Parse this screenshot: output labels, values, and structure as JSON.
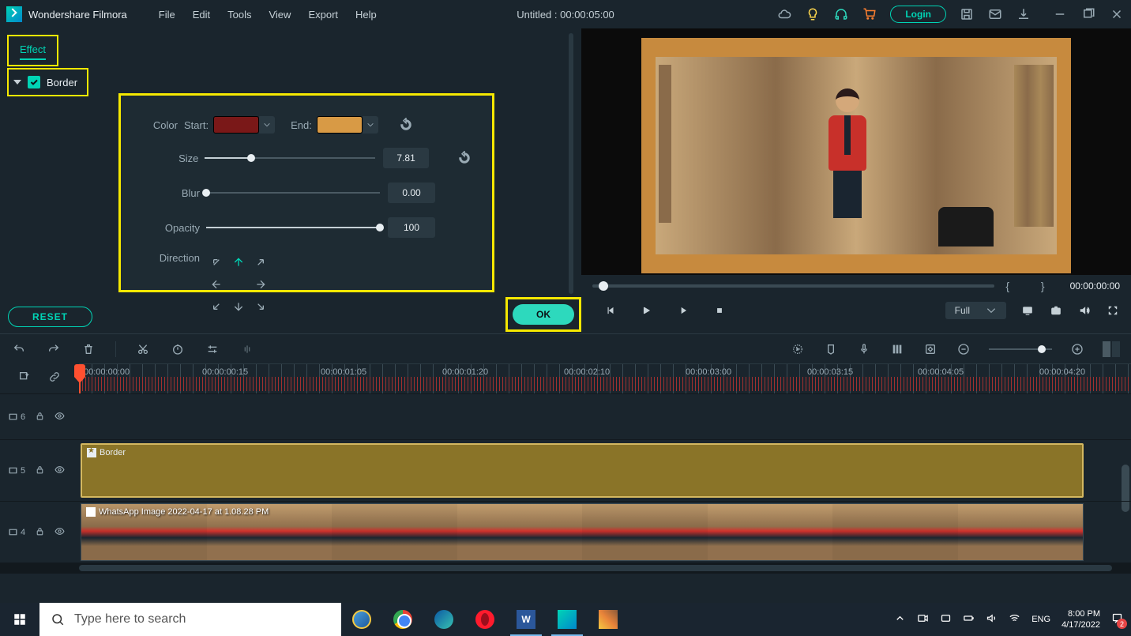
{
  "app": {
    "name": "Wondershare Filmora",
    "project_title": "Untitled : 00:00:05:00"
  },
  "menu": {
    "file": "File",
    "edit": "Edit",
    "tools": "Tools",
    "view": "View",
    "export": "Export",
    "help": "Help"
  },
  "titlebar": {
    "login": "Login"
  },
  "effect": {
    "tab_label": "Effect",
    "section_label": "Border",
    "color_label": "Color",
    "start_label": "Start:",
    "end_label": "End:",
    "size_label": "Size",
    "size_value": "7.81",
    "blur_label": "Blur",
    "blur_value": "0.00",
    "opacity_label": "Opacity",
    "opacity_value": "100",
    "direction_label": "Direction",
    "colors": {
      "start": "#7a1818",
      "end": "#d89a45"
    }
  },
  "buttons": {
    "reset": "RESET",
    "ok": "OK"
  },
  "preview": {
    "timecode": "00:00:00:00",
    "quality": "Full"
  },
  "timeline": {
    "marks": [
      "00:00:00:00",
      "00:00:00:15",
      "00:00:01:05",
      "00:00:01:20",
      "00:00:02:10",
      "00:00:03:00",
      "00:00:03:15",
      "00:00:04:05",
      "00:00:04:20"
    ],
    "tracks": {
      "t6": "6",
      "t5": "5",
      "t4": "4"
    },
    "border_clip_label": "Border",
    "video_clip_label": "WhatsApp Image 2022-04-17 at 1.08.28 PM"
  },
  "taskbar": {
    "search_placeholder": "Type here to search",
    "lang": "ENG",
    "time": "8:00 PM",
    "date": "4/17/2022",
    "word_letter": "W"
  }
}
